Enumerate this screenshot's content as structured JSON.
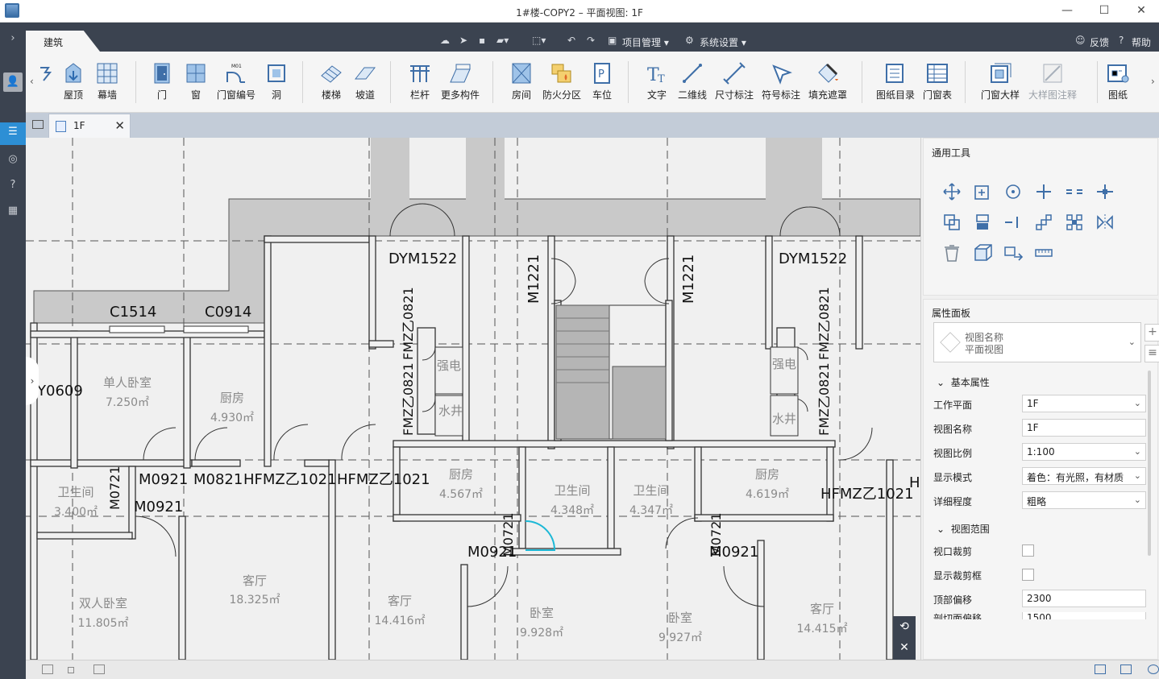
{
  "window": {
    "title": "1#楼-COPY2 – 平面视图: 1F",
    "minimize": "—",
    "maximize": "☐",
    "close": "✕"
  },
  "ribbon_tab": {
    "label": "建筑"
  },
  "quick_access": {
    "project_mgmt": "项目管理",
    "system_settings": "系统设置",
    "feedback": "反馈",
    "help": "帮助"
  },
  "ribbon": {
    "buttons": [
      {
        "id": "roof",
        "label": "屋顶"
      },
      {
        "id": "curtain-wall",
        "label": "幕墙"
      },
      {
        "id": "door",
        "label": "门"
      },
      {
        "id": "window",
        "label": "窗"
      },
      {
        "id": "door-window-tag",
        "label": "门窗编号"
      },
      {
        "id": "opening",
        "label": "洞"
      },
      {
        "id": "stairs",
        "label": "楼梯"
      },
      {
        "id": "ramp",
        "label": "坡道"
      },
      {
        "id": "railing",
        "label": "栏杆"
      },
      {
        "id": "more-components",
        "label": "更多构件"
      },
      {
        "id": "room",
        "label": "房间"
      },
      {
        "id": "fire-zone",
        "label": "防火分区"
      },
      {
        "id": "parking",
        "label": "车位"
      },
      {
        "id": "text",
        "label": "文字"
      },
      {
        "id": "qrcode",
        "label": "二维线"
      },
      {
        "id": "dimension",
        "label": "尺寸标注"
      },
      {
        "id": "symbol-annotation",
        "label": "符号标注"
      },
      {
        "id": "fill-mask",
        "label": "填充遮罩"
      },
      {
        "id": "drawing-list",
        "label": "图纸目录"
      },
      {
        "id": "door-window-table",
        "label": "门窗表"
      },
      {
        "id": "door-window-detail",
        "label": "门窗大样"
      },
      {
        "id": "detail-annotation",
        "label": "大样图注释"
      },
      {
        "id": "drawing",
        "label": "图纸"
      }
    ]
  },
  "doc_tab": {
    "label": "1F"
  },
  "plan": {
    "window_tags": [
      "C1514",
      "C0914",
      "Y0609"
    ],
    "door_tags": [
      "DYM1522",
      "DYM1522",
      "M1221",
      "M1221",
      "FMZ乙0821",
      "FMZ乙0821",
      "FMZ乙0821",
      "FMZ乙0821",
      "M0921",
      "M0821",
      "HFMZ乙1021",
      "HFMZ乙1021",
      "HFMZ乙1021",
      "M0721",
      "M0921",
      "M0921",
      "M0721",
      "M0921",
      "M0721",
      "H"
    ],
    "rooms": [
      {
        "name": "单人卧室",
        "area": "7.250㎡"
      },
      {
        "name": "厨房",
        "area": "4.930㎡"
      },
      {
        "name": "卫生间",
        "area": "3.400㎡"
      },
      {
        "name": "客厅",
        "area": "18.325㎡"
      },
      {
        "name": "双人卧室",
        "area": "11.805㎡"
      },
      {
        "name": "客厅",
        "area": "14.416㎡"
      },
      {
        "name": "厨房",
        "area": "4.567㎡"
      },
      {
        "name": "卫生间",
        "area": "4.348㎡"
      },
      {
        "name": "卫生间",
        "area": "4.347㎡"
      },
      {
        "name": "厨房",
        "area": "4.619㎡"
      },
      {
        "name": "卧室",
        "area": "9.928㎡"
      },
      {
        "name": "卧室",
        "area": "9.927㎡"
      },
      {
        "name": "客厅",
        "area": "14.415㎡"
      }
    ],
    "shafts": [
      "强电",
      "水井",
      "强电",
      "水井"
    ]
  },
  "right_panel": {
    "tools_title": "通用工具",
    "props_title": "属性面板",
    "view_selector": {
      "line1": "视图名称",
      "line2": "平面视图"
    },
    "section_basic": "基本属性",
    "section_range": "视图范围",
    "props": [
      {
        "label": "工作平面",
        "value": "1F"
      },
      {
        "label": "视图名称",
        "value": "1F"
      },
      {
        "label": "视图比例",
        "value": "1:100"
      },
      {
        "label": "显示模式",
        "value": "着色：有光照，有材质"
      },
      {
        "label": "详细程度",
        "value": "粗略"
      }
    ],
    "checks": [
      {
        "label": "视口裁剪"
      },
      {
        "label": "显示裁剪框"
      }
    ],
    "top_offset": {
      "label": "顶部偏移",
      "value": "2300"
    },
    "cut_offset": {
      "label": "剖切面偏移",
      "value": "1500"
    }
  }
}
